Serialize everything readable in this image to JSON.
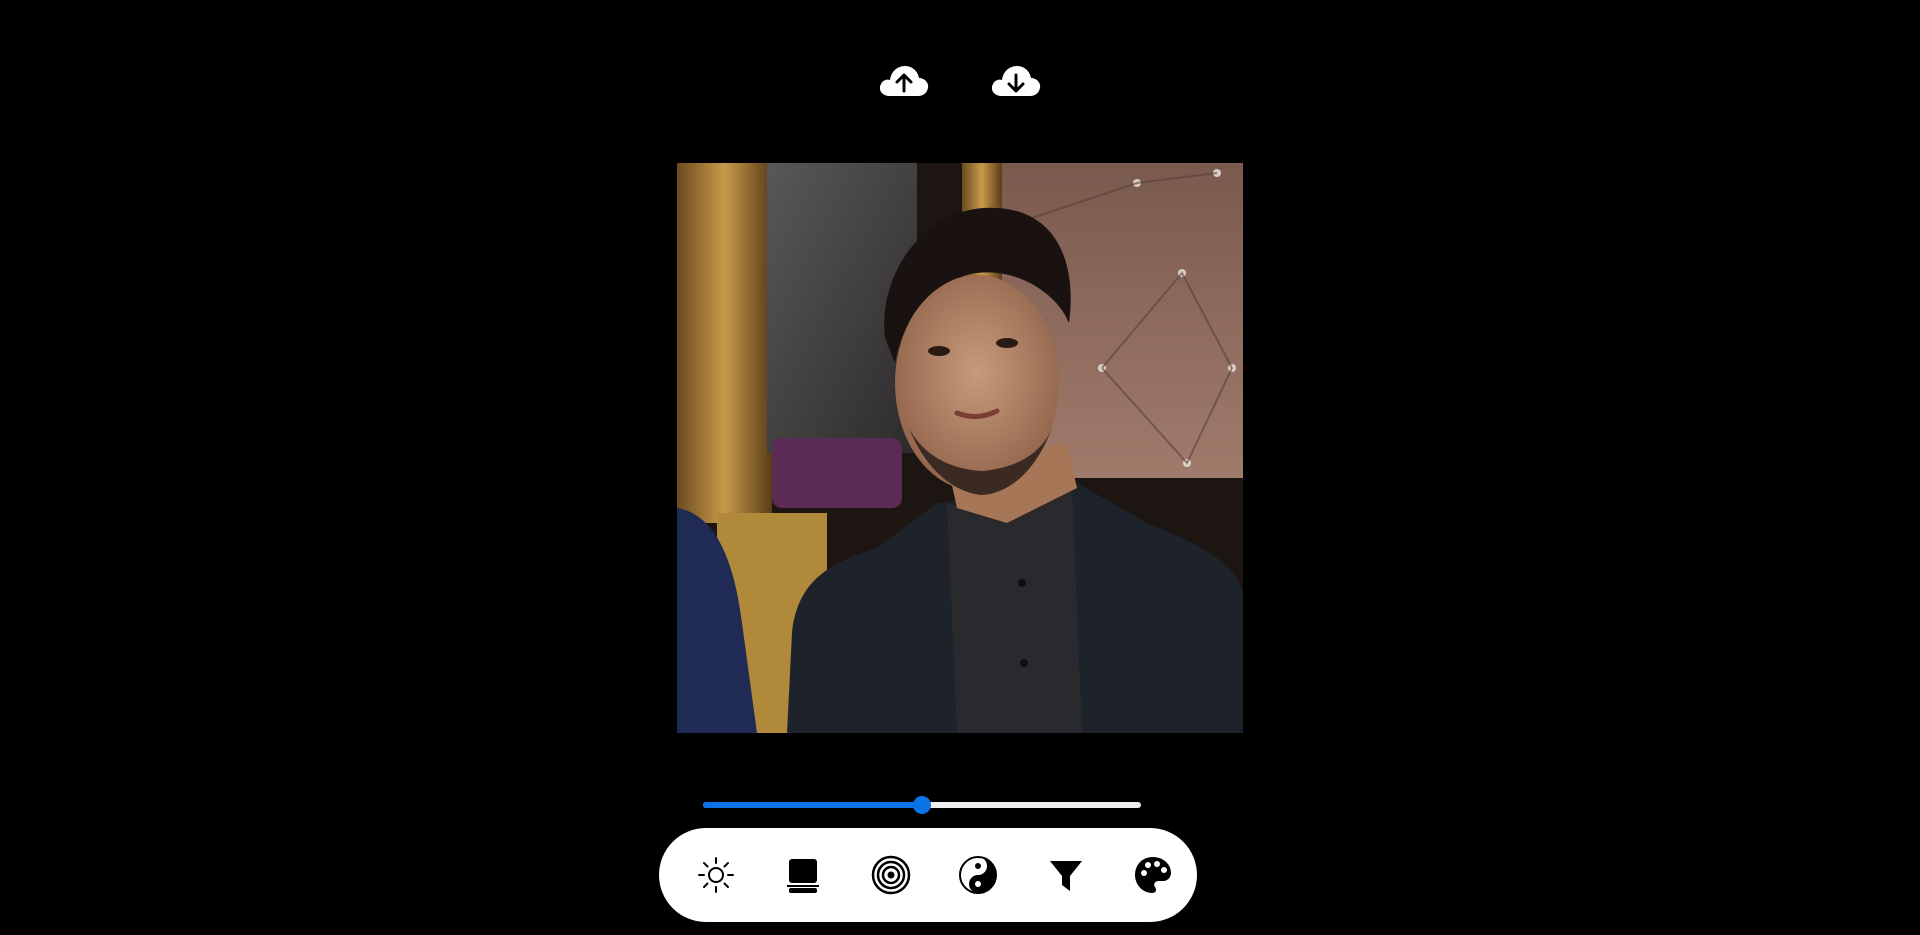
{
  "header": {
    "upload_icon": "cloud-upload-icon",
    "download_icon": "cloud-download-icon"
  },
  "photo": {
    "description_icon": "portrait-image"
  },
  "slider": {
    "value": 0.5,
    "accent_color": "#0b72e7",
    "track_color": "#efefef"
  },
  "toolbar": {
    "tools": [
      {
        "id": "brightness",
        "icon": "sun-icon"
      },
      {
        "id": "contrast",
        "icon": "contrast-icon"
      },
      {
        "id": "blur",
        "icon": "concentric-circles-icon"
      },
      {
        "id": "grayscale",
        "icon": "yin-yang-icon"
      },
      {
        "id": "filter",
        "icon": "funnel-icon"
      },
      {
        "id": "color",
        "icon": "palette-icon"
      }
    ]
  },
  "colors": {
    "background": "#000000",
    "toolbar_bg": "#ffffff",
    "icon_color": "#000000"
  }
}
